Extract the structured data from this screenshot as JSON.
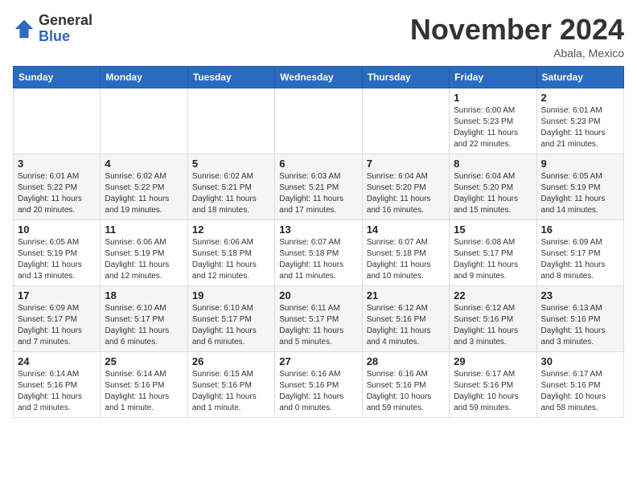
{
  "header": {
    "logo_general": "General",
    "logo_blue": "Blue",
    "month_title": "November 2024",
    "location": "Abala, Mexico"
  },
  "calendar": {
    "days_of_week": [
      "Sunday",
      "Monday",
      "Tuesday",
      "Wednesday",
      "Thursday",
      "Friday",
      "Saturday"
    ],
    "weeks": [
      [
        {
          "day": "",
          "info": ""
        },
        {
          "day": "",
          "info": ""
        },
        {
          "day": "",
          "info": ""
        },
        {
          "day": "",
          "info": ""
        },
        {
          "day": "",
          "info": ""
        },
        {
          "day": "1",
          "info": "Sunrise: 6:00 AM\nSunset: 5:23 PM\nDaylight: 11 hours and 22 minutes."
        },
        {
          "day": "2",
          "info": "Sunrise: 6:01 AM\nSunset: 5:23 PM\nDaylight: 11 hours and 21 minutes."
        }
      ],
      [
        {
          "day": "3",
          "info": "Sunrise: 6:01 AM\nSunset: 5:22 PM\nDaylight: 11 hours and 20 minutes."
        },
        {
          "day": "4",
          "info": "Sunrise: 6:02 AM\nSunset: 5:22 PM\nDaylight: 11 hours and 19 minutes."
        },
        {
          "day": "5",
          "info": "Sunrise: 6:02 AM\nSunset: 5:21 PM\nDaylight: 11 hours and 18 minutes."
        },
        {
          "day": "6",
          "info": "Sunrise: 6:03 AM\nSunset: 5:21 PM\nDaylight: 11 hours and 17 minutes."
        },
        {
          "day": "7",
          "info": "Sunrise: 6:04 AM\nSunset: 5:20 PM\nDaylight: 11 hours and 16 minutes."
        },
        {
          "day": "8",
          "info": "Sunrise: 6:04 AM\nSunset: 5:20 PM\nDaylight: 11 hours and 15 minutes."
        },
        {
          "day": "9",
          "info": "Sunrise: 6:05 AM\nSunset: 5:19 PM\nDaylight: 11 hours and 14 minutes."
        }
      ],
      [
        {
          "day": "10",
          "info": "Sunrise: 6:05 AM\nSunset: 5:19 PM\nDaylight: 11 hours and 13 minutes."
        },
        {
          "day": "11",
          "info": "Sunrise: 6:06 AM\nSunset: 5:19 PM\nDaylight: 11 hours and 12 minutes."
        },
        {
          "day": "12",
          "info": "Sunrise: 6:06 AM\nSunset: 5:18 PM\nDaylight: 11 hours and 12 minutes."
        },
        {
          "day": "13",
          "info": "Sunrise: 6:07 AM\nSunset: 5:18 PM\nDaylight: 11 hours and 11 minutes."
        },
        {
          "day": "14",
          "info": "Sunrise: 6:07 AM\nSunset: 5:18 PM\nDaylight: 11 hours and 10 minutes."
        },
        {
          "day": "15",
          "info": "Sunrise: 6:08 AM\nSunset: 5:17 PM\nDaylight: 11 hours and 9 minutes."
        },
        {
          "day": "16",
          "info": "Sunrise: 6:09 AM\nSunset: 5:17 PM\nDaylight: 11 hours and 8 minutes."
        }
      ],
      [
        {
          "day": "17",
          "info": "Sunrise: 6:09 AM\nSunset: 5:17 PM\nDaylight: 11 hours and 7 minutes."
        },
        {
          "day": "18",
          "info": "Sunrise: 6:10 AM\nSunset: 5:17 PM\nDaylight: 11 hours and 6 minutes."
        },
        {
          "day": "19",
          "info": "Sunrise: 6:10 AM\nSunset: 5:17 PM\nDaylight: 11 hours and 6 minutes."
        },
        {
          "day": "20",
          "info": "Sunrise: 6:11 AM\nSunset: 5:17 PM\nDaylight: 11 hours and 5 minutes."
        },
        {
          "day": "21",
          "info": "Sunrise: 6:12 AM\nSunset: 5:16 PM\nDaylight: 11 hours and 4 minutes."
        },
        {
          "day": "22",
          "info": "Sunrise: 6:12 AM\nSunset: 5:16 PM\nDaylight: 11 hours and 3 minutes."
        },
        {
          "day": "23",
          "info": "Sunrise: 6:13 AM\nSunset: 5:16 PM\nDaylight: 11 hours and 3 minutes."
        }
      ],
      [
        {
          "day": "24",
          "info": "Sunrise: 6:14 AM\nSunset: 5:16 PM\nDaylight: 11 hours and 2 minutes."
        },
        {
          "day": "25",
          "info": "Sunrise: 6:14 AM\nSunset: 5:16 PM\nDaylight: 11 hours and 1 minute."
        },
        {
          "day": "26",
          "info": "Sunrise: 6:15 AM\nSunset: 5:16 PM\nDaylight: 11 hours and 1 minute."
        },
        {
          "day": "27",
          "info": "Sunrise: 6:16 AM\nSunset: 5:16 PM\nDaylight: 11 hours and 0 minutes."
        },
        {
          "day": "28",
          "info": "Sunrise: 6:16 AM\nSunset: 5:16 PM\nDaylight: 10 hours and 59 minutes."
        },
        {
          "day": "29",
          "info": "Sunrise: 6:17 AM\nSunset: 5:16 PM\nDaylight: 10 hours and 59 minutes."
        },
        {
          "day": "30",
          "info": "Sunrise: 6:17 AM\nSunset: 5:16 PM\nDaylight: 10 hours and 58 minutes."
        }
      ]
    ]
  }
}
